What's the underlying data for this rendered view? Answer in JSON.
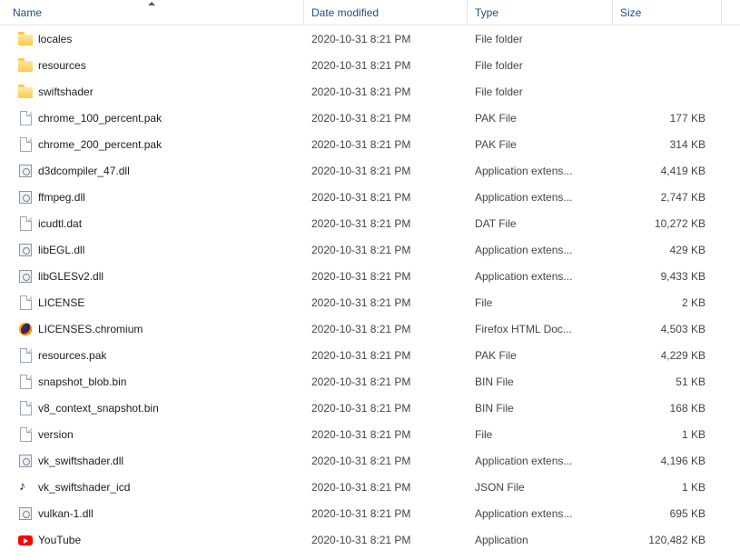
{
  "columns": {
    "name": "Name",
    "date": "Date modified",
    "type": "Type",
    "size": "Size"
  },
  "files": [
    {
      "icon": "folder",
      "name": "locales",
      "date": "2020-10-31 8:21 PM",
      "type": "File folder",
      "size": ""
    },
    {
      "icon": "folder",
      "name": "resources",
      "date": "2020-10-31 8:21 PM",
      "type": "File folder",
      "size": ""
    },
    {
      "icon": "folder",
      "name": "swiftshader",
      "date": "2020-10-31 8:21 PM",
      "type": "File folder",
      "size": ""
    },
    {
      "icon": "file",
      "name": "chrome_100_percent.pak",
      "date": "2020-10-31 8:21 PM",
      "type": "PAK File",
      "size": "177 KB"
    },
    {
      "icon": "file",
      "name": "chrome_200_percent.pak",
      "date": "2020-10-31 8:21 PM",
      "type": "PAK File",
      "size": "314 KB"
    },
    {
      "icon": "dll",
      "name": "d3dcompiler_47.dll",
      "date": "2020-10-31 8:21 PM",
      "type": "Application extens...",
      "size": "4,419 KB"
    },
    {
      "icon": "dll",
      "name": "ffmpeg.dll",
      "date": "2020-10-31 8:21 PM",
      "type": "Application extens...",
      "size": "2,747 KB"
    },
    {
      "icon": "file",
      "name": "icudtl.dat",
      "date": "2020-10-31 8:21 PM",
      "type": "DAT File",
      "size": "10,272 KB"
    },
    {
      "icon": "dll",
      "name": "libEGL.dll",
      "date": "2020-10-31 8:21 PM",
      "type": "Application extens...",
      "size": "429 KB"
    },
    {
      "icon": "dll",
      "name": "libGLESv2.dll",
      "date": "2020-10-31 8:21 PM",
      "type": "Application extens...",
      "size": "9,433 KB"
    },
    {
      "icon": "file",
      "name": "LICENSE",
      "date": "2020-10-31 8:21 PM",
      "type": "File",
      "size": "2 KB"
    },
    {
      "icon": "firefox",
      "name": "LICENSES.chromium",
      "date": "2020-10-31 8:21 PM",
      "type": "Firefox HTML Doc...",
      "size": "4,503 KB"
    },
    {
      "icon": "file",
      "name": "resources.pak",
      "date": "2020-10-31 8:21 PM",
      "type": "PAK File",
      "size": "4,229 KB"
    },
    {
      "icon": "file",
      "name": "snapshot_blob.bin",
      "date": "2020-10-31 8:21 PM",
      "type": "BIN File",
      "size": "51 KB"
    },
    {
      "icon": "file",
      "name": "v8_context_snapshot.bin",
      "date": "2020-10-31 8:21 PM",
      "type": "BIN File",
      "size": "168 KB"
    },
    {
      "icon": "file",
      "name": "version",
      "date": "2020-10-31 8:21 PM",
      "type": "File",
      "size": "1 KB"
    },
    {
      "icon": "dll",
      "name": "vk_swiftshader.dll",
      "date": "2020-10-31 8:21 PM",
      "type": "Application extens...",
      "size": "4,196 KB"
    },
    {
      "icon": "json",
      "name": "vk_swiftshader_icd",
      "date": "2020-10-31 8:21 PM",
      "type": "JSON File",
      "size": "1 KB"
    },
    {
      "icon": "dll",
      "name": "vulkan-1.dll",
      "date": "2020-10-31 8:21 PM",
      "type": "Application extens...",
      "size": "695 KB"
    },
    {
      "icon": "youtube",
      "name": "YouTube",
      "date": "2020-10-31 8:21 PM",
      "type": "Application",
      "size": "120,482 KB"
    }
  ]
}
